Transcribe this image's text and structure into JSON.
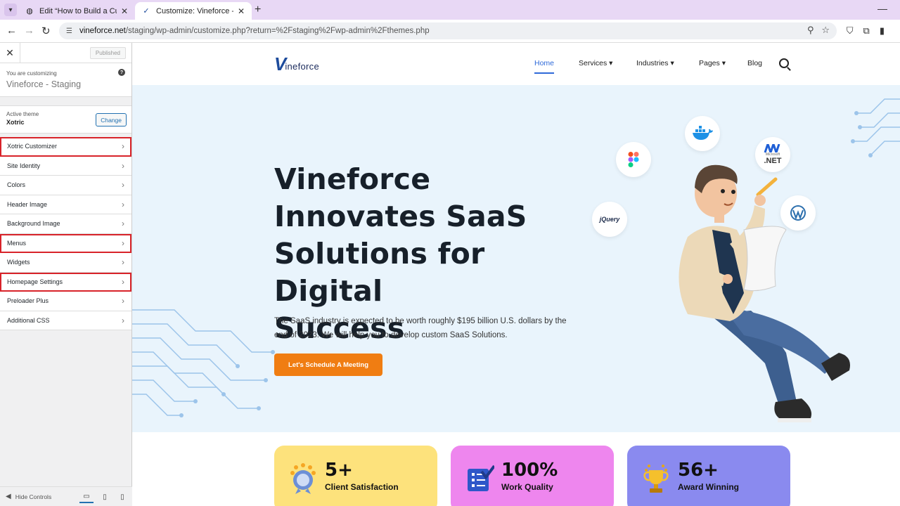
{
  "browser": {
    "tabs": [
      {
        "label": "Edit “How to Build a Custom W",
        "active": false
      },
      {
        "label": "Customize: Vineforce - SaaS So",
        "active": true
      }
    ],
    "url_domain": "vineforce.net",
    "url_path": "/staging/wp-admin/customize.php?return=%2Fstaging%2Fwp-admin%2Fthemes.php"
  },
  "sidebar": {
    "published_label": "Published",
    "customizing_label": "You are customizing",
    "site_name": "Vineforce - Staging",
    "active_theme_label": "Active theme",
    "theme_name": "Xotric",
    "change_label": "Change",
    "items": [
      {
        "label": "Xotric Customizer",
        "highlighted": true
      },
      {
        "label": "Site Identity",
        "highlighted": false
      },
      {
        "label": "Colors",
        "highlighted": false
      },
      {
        "label": "Header Image",
        "highlighted": false
      },
      {
        "label": "Background Image",
        "highlighted": false
      },
      {
        "label": "Menus",
        "highlighted": true
      },
      {
        "label": "Widgets",
        "highlighted": false
      },
      {
        "label": "Homepage Settings",
        "highlighted": true
      },
      {
        "label": "Preloader Plus",
        "highlighted": false
      },
      {
        "label": "Additional CSS",
        "highlighted": false
      }
    ],
    "hide_controls_label": "Hide Controls"
  },
  "site": {
    "logo_mark": "V",
    "logo_text": "ineforce",
    "nav": [
      {
        "label": "Home"
      },
      {
        "label": "Services ▾"
      },
      {
        "label": "Industries ▾"
      },
      {
        "label": "Pages ▾"
      },
      {
        "label": "Blog"
      }
    ],
    "hero": {
      "title_lines": [
        "Vineforce",
        "Innovates SaaS",
        "Solutions for Digital",
        "Success"
      ],
      "description_lines": [
        "The SaaS industry is expected to be worth roughly $195 billion U.S. dollars by the",
        "end of 2023. We will help you to develop custom SaaS Solutions."
      ],
      "cta_label": "Let's Schedule A Meeting"
    },
    "tech_badges": [
      "jQuery",
      ".NET",
      "Microsoft"
    ],
    "stats": [
      {
        "number": "5+",
        "label": "Client Satisfaction",
        "color": "#fde27c",
        "icon": "medal-icon"
      },
      {
        "number": "100%",
        "label": "Work Quality",
        "color": "#ee86ee",
        "icon": "checklist-icon"
      },
      {
        "number": "56+",
        "label": "Award Winning",
        "color": "#8a8aef",
        "icon": "trophy-icon"
      }
    ]
  },
  "colors": {
    "accent": "#2f6ad9",
    "cta": "#f07d12",
    "highlight": "#d8232a",
    "hero_bg": "#e9f4fc"
  }
}
